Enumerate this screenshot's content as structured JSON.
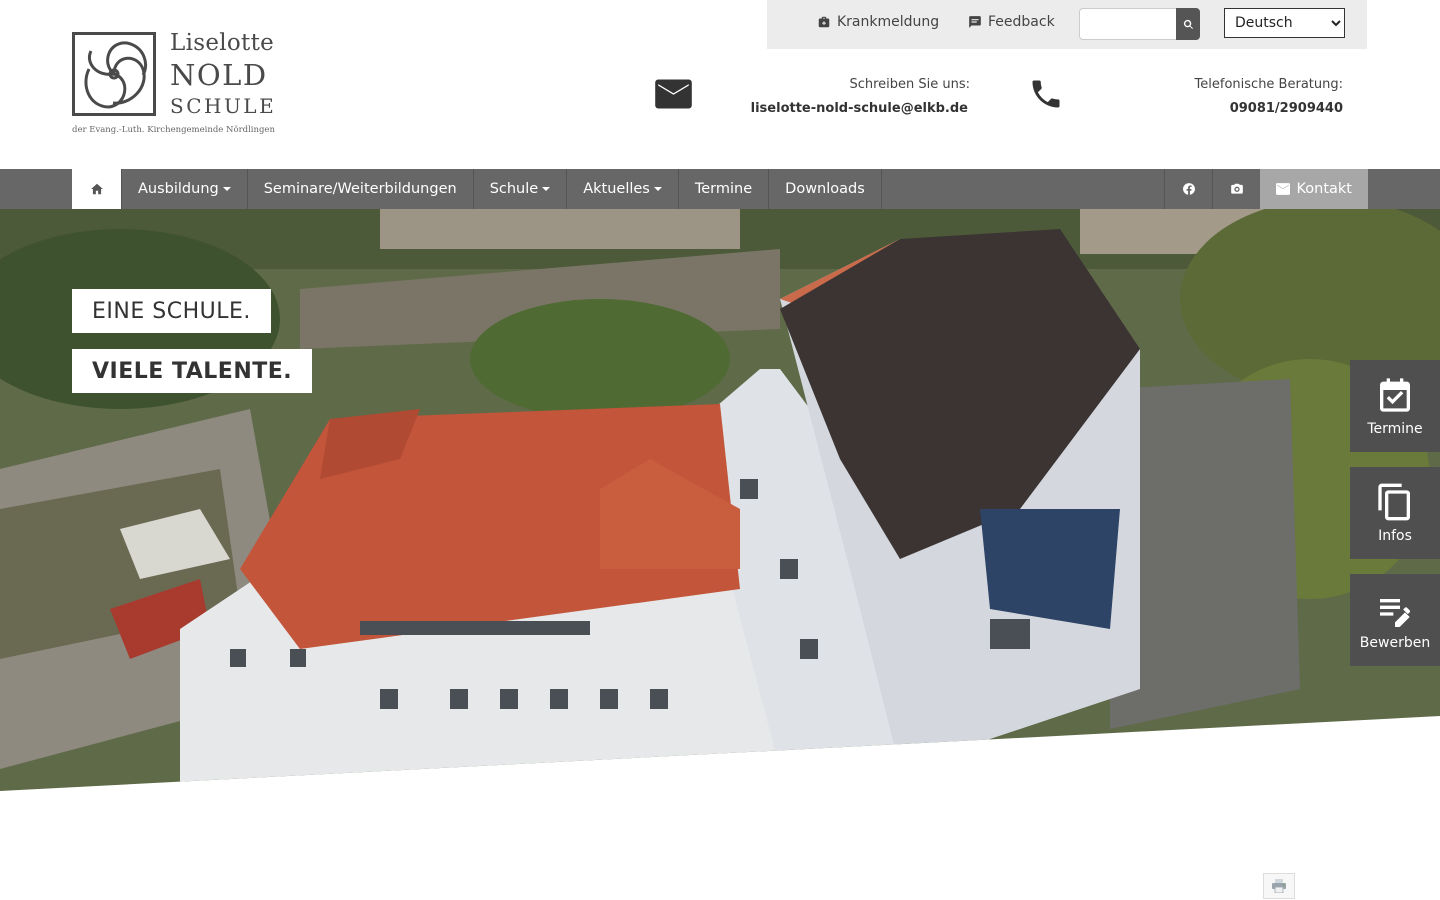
{
  "utility": {
    "sick_note": "Krankmeldung",
    "feedback": "Feedback",
    "search_placeholder": "",
    "language": "Deutsch"
  },
  "logo": {
    "line1": "Liselotte",
    "line2": "NOLD",
    "line3": "SCHULE",
    "subline": "der Evang.-Luth. Kirchengemeinde Nördlingen"
  },
  "contact": {
    "mail_label": "Schreiben Sie uns:",
    "mail_value": "liselotte-nold-schule@elkb.de",
    "phone_label": "Telefonische Beratung:",
    "phone_value": "09081/2909440"
  },
  "nav": {
    "items": [
      {
        "label": "Ausbildung",
        "dropdown": true
      },
      {
        "label": "Seminare/Weiterbildungen",
        "dropdown": false
      },
      {
        "label": "Schule",
        "dropdown": true
      },
      {
        "label": "Aktuelles",
        "dropdown": true
      },
      {
        "label": "Termine",
        "dropdown": false
      },
      {
        "label": "Downloads",
        "dropdown": false
      }
    ],
    "kontakt": "Kontakt"
  },
  "hero": {
    "tag1": "EINE SCHULE.",
    "tag2": "VIELE TALENTE."
  },
  "side": {
    "termine": "Termine",
    "infos": "Infos",
    "bewerben": "Bewerben"
  },
  "icons": {
    "home": "home-icon",
    "facebook": "facebook-icon",
    "instagram": "camera-icon",
    "mail": "mail-icon",
    "phone": "phone-icon",
    "print": "print-icon"
  },
  "colors": {
    "nav_bg": "#676767",
    "side_bg": "#4f4f4f",
    "kontakt_bg": "#a7a7a7",
    "utility_bg": "#ececec"
  }
}
